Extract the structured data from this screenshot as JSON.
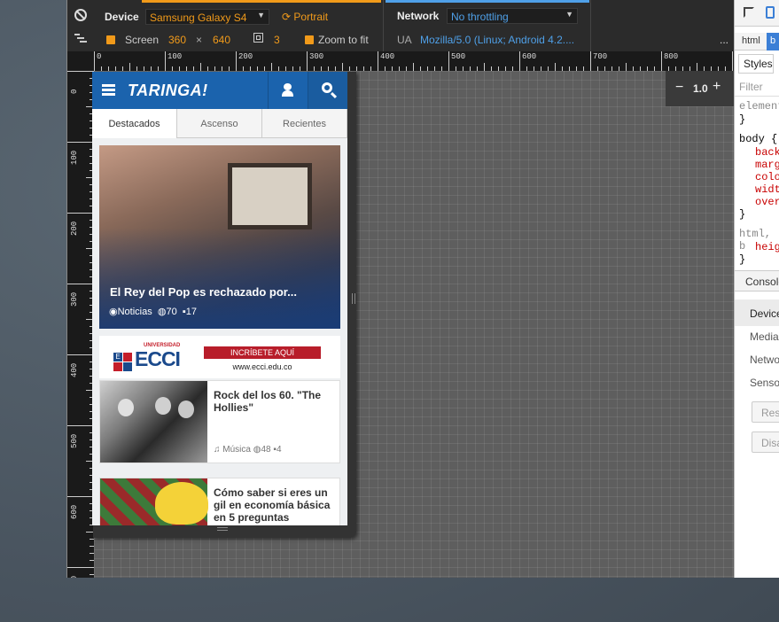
{
  "toolbar": {
    "device_label": "Device",
    "device_value": "Samsung Galaxy S4",
    "portrait_label": "Portrait",
    "network_label": "Network",
    "network_value": "No throttling",
    "screen_label": "Screen",
    "screen_width": "360",
    "screen_x": "×",
    "screen_height": "640",
    "dpr_value": "3",
    "zoom_to_fit_label": "Zoom to fit",
    "ua_label": "UA",
    "ua_value": "Mozilla/5.0 (Linux; Android 4.2....",
    "more_label": "..."
  },
  "ruler": {
    "h_labels": [
      "0",
      "100",
      "200",
      "300",
      "400",
      "500",
      "600",
      "700",
      "800"
    ],
    "v_labels": [
      "0",
      "100",
      "200",
      "300",
      "400",
      "500",
      "600",
      "700"
    ]
  },
  "zoom": {
    "minus": "−",
    "value": "1.0",
    "plus": "+"
  },
  "site": {
    "logo": "TARINGA!",
    "tabs": [
      "Destacados",
      "Ascenso",
      "Recientes"
    ],
    "featured": {
      "title": "El Rey del Pop es rechazado por...",
      "category": "Noticias",
      "comments": "70",
      "replies": "17"
    },
    "ad": {
      "logo_small": "UNIVERSIDAD",
      "logo_big": "ECCI",
      "cta": "INCRÍBETE AQUÍ",
      "url": "www.ecci.edu.co"
    },
    "posts": [
      {
        "title": "Rock del los 60. \"The Hollies\"",
        "category": "Música",
        "comments": "48",
        "replies": "4"
      },
      {
        "title": "Cómo saber si eres un gil en economía básica en 5 preguntas",
        "category": "",
        "comments": "",
        "replies": ""
      }
    ]
  },
  "devtools": {
    "tabs": [
      "html",
      "b"
    ],
    "styles_tab": "Styles",
    "filter_placeholder": "Filter",
    "code": [
      "element",
      "}",
      "body {",
      "back",
      "marg",
      "colo",
      "widt",
      "over",
      "}",
      "html, b",
      "heig",
      "}"
    ],
    "console_tab": "Console",
    "drawer_items": [
      "Device",
      "Media",
      "Netwo",
      "Sensor"
    ],
    "buttons": [
      "Res",
      "Disa"
    ]
  },
  "colors": {
    "accent_orange": "#f19a1a",
    "accent_blue": "#4fa0e8",
    "taringa_blue": "#1b63ad"
  }
}
